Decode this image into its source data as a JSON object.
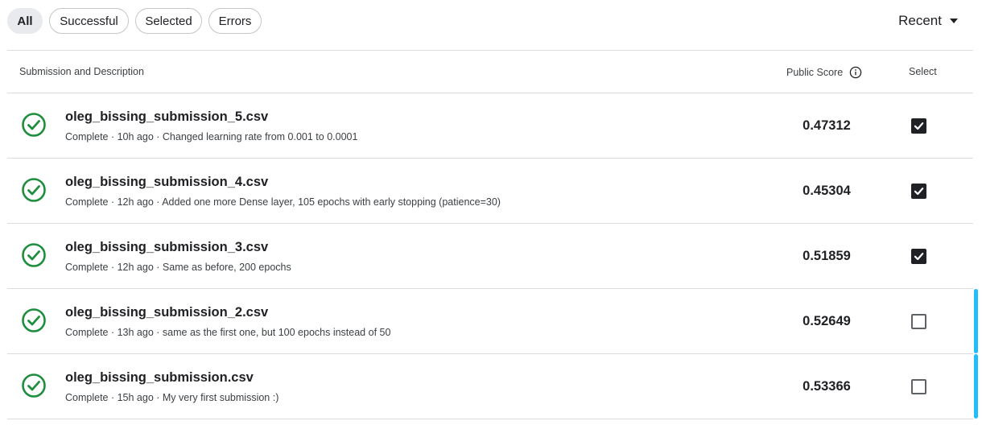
{
  "filters": [
    {
      "label": "All",
      "active": true
    },
    {
      "label": "Successful",
      "active": false
    },
    {
      "label": "Selected",
      "active": false
    },
    {
      "label": "Errors",
      "active": false
    }
  ],
  "sort": {
    "label": "Recent"
  },
  "table": {
    "headers": {
      "description": "Submission and Description",
      "score": "Public Score",
      "select": "Select"
    },
    "rows": [
      {
        "file": "oleg_bissing_submission_5.csv",
        "description": "Complete · 10h ago · Changed learning rate from 0.001 to 0.0001",
        "score": "0.47312",
        "selected": true
      },
      {
        "file": "oleg_bissing_submission_4.csv",
        "description": "Complete · 12h ago · Added one more Dense layer, 105 epochs with early stopping (patience=30)",
        "score": "0.45304",
        "selected": true
      },
      {
        "file": "oleg_bissing_submission_3.csv",
        "description": "Complete · 12h ago · Same as before, 200 epochs",
        "score": "0.51859",
        "selected": true
      },
      {
        "file": "oleg_bissing_submission_2.csv",
        "description": "Complete · 13h ago · same as the first one, but 100 epochs instead of 50",
        "score": "0.52649",
        "selected": false
      },
      {
        "file": "oleg_bissing_submission.csv",
        "description": "Complete · 15h ago · My very first submission :)",
        "score": "0.53366",
        "selected": false
      }
    ]
  },
  "colors": {
    "success": "#1e8e3e",
    "accent": "#20beff",
    "checkbox": "#202124"
  },
  "icons": {
    "status": "check-circle-icon",
    "info": "info-icon",
    "sort": "caret-down-icon"
  }
}
